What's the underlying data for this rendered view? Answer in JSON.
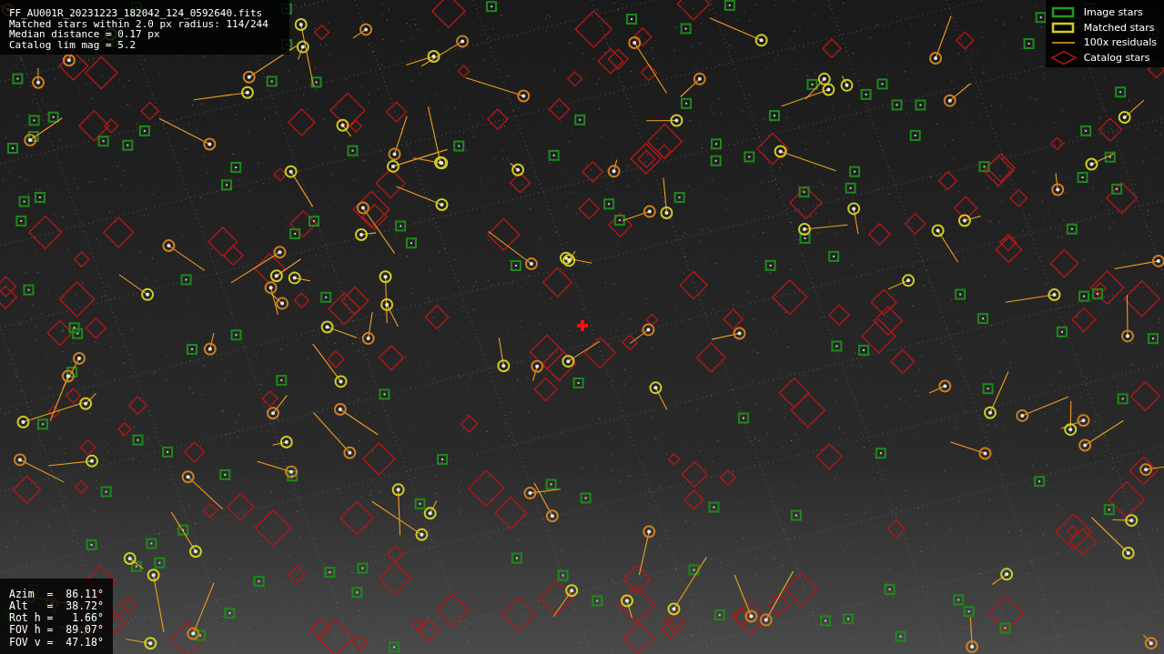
{
  "header": {
    "lines": [
      "FF_AU001R_20231223_182042_124_0592640.fits",
      "Matched stars within 2.0 px radius: 114/244",
      "Median distance = 0.17 px",
      "Catalog lim mag = 5.2"
    ]
  },
  "legend": [
    {
      "kind": "image",
      "label": "Image stars"
    },
    {
      "kind": "matched",
      "label": "Matched stars"
    },
    {
      "kind": "residual",
      "label": "100x residuals"
    },
    {
      "kind": "catalog",
      "label": "Catalog stars"
    }
  ],
  "pointing": {
    "lines": [
      "Azim  =  86.11°",
      "Alt   =  38.72°",
      "Rot h =   1.66°",
      "FOV h =  89.07°",
      "FOV v =  47.18°"
    ]
  }
}
